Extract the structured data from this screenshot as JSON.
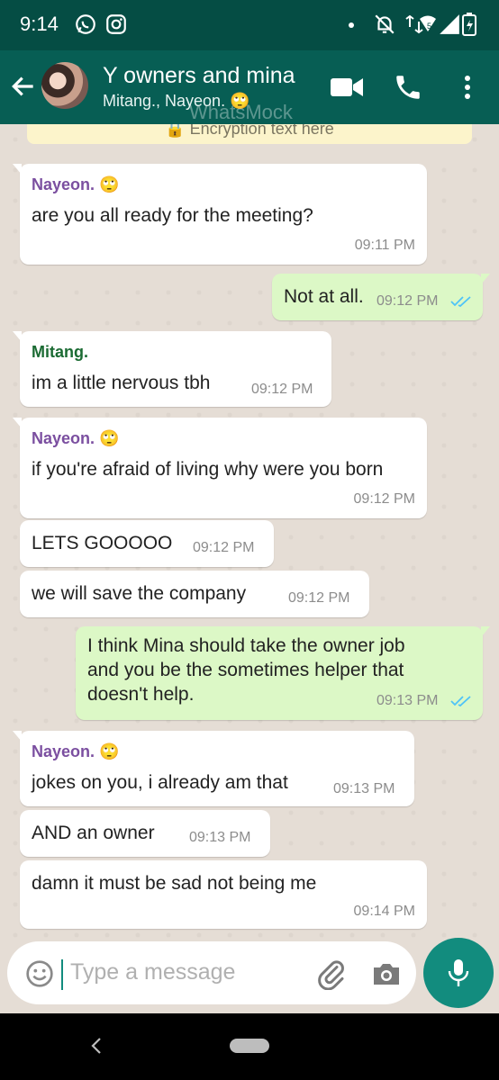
{
  "status_bar": {
    "time": "9:14",
    "network": "5"
  },
  "header": {
    "title": "Y owners and mina",
    "subtitle": "Mitang., Nayeon. 🙄",
    "watermark": "WhatsMock"
  },
  "chat": {
    "encryption_text": "🔒 Encryption text here",
    "messages": [
      {
        "direction": "in",
        "sender": "Nayeon. 🙄",
        "sender_color": "#7b4fa0",
        "lines": [
          "are you all ready for the meeting?"
        ],
        "time": "09:11 PM"
      },
      {
        "direction": "out",
        "lines": [
          "Not at all."
        ],
        "time": "09:12 PM",
        "status": "read"
      },
      {
        "direction": "in",
        "sender": "Mitang.",
        "sender_color": "#1b6b33",
        "lines": [
          "im a little nervous tbh"
        ],
        "time": "09:12 PM"
      },
      {
        "direction": "in",
        "sender": "Nayeon. 🙄",
        "sender_color": "#7b4fa0",
        "lines": [
          "if you're afraid of living why were you born"
        ],
        "time": "09:12 PM"
      },
      {
        "direction": "in",
        "lines": [
          "LETS GOOOOO"
        ],
        "time": "09:12 PM"
      },
      {
        "direction": "in",
        "lines": [
          "we will save the company"
        ],
        "time": "09:12 PM"
      },
      {
        "direction": "out",
        "lines": [
          "I think Mina should take the owner job",
          "and you be the sometimes helper that",
          "doesn't help."
        ],
        "time": "09:13 PM",
        "status": "read"
      },
      {
        "direction": "in",
        "sender": "Nayeon. 🙄",
        "sender_color": "#7b4fa0",
        "lines": [
          "jokes on you, i already am that"
        ],
        "time": "09:13 PM"
      },
      {
        "direction": "in",
        "lines": [
          "AND an owner"
        ],
        "time": "09:13 PM"
      },
      {
        "direction": "in",
        "lines": [
          "damn it must be sad not being me"
        ],
        "time": "09:14 PM"
      }
    ]
  },
  "input": {
    "placeholder": "Type a message"
  },
  "colors": {
    "header": "#075e54",
    "status_bar": "#054d44",
    "accent": "#128c7e",
    "outgoing_bubble": "#dcf8c6",
    "read_ticks": "#4fc3f7"
  },
  "icons": [
    "whatsapp-icon",
    "instagram-icon",
    "mute-icon",
    "wifi-icon",
    "signal-icon",
    "battery-icon",
    "back-arrow-icon",
    "video-call-icon",
    "phone-icon",
    "more-vert-icon",
    "emoji-icon",
    "attach-icon",
    "camera-icon",
    "mic-icon"
  ]
}
